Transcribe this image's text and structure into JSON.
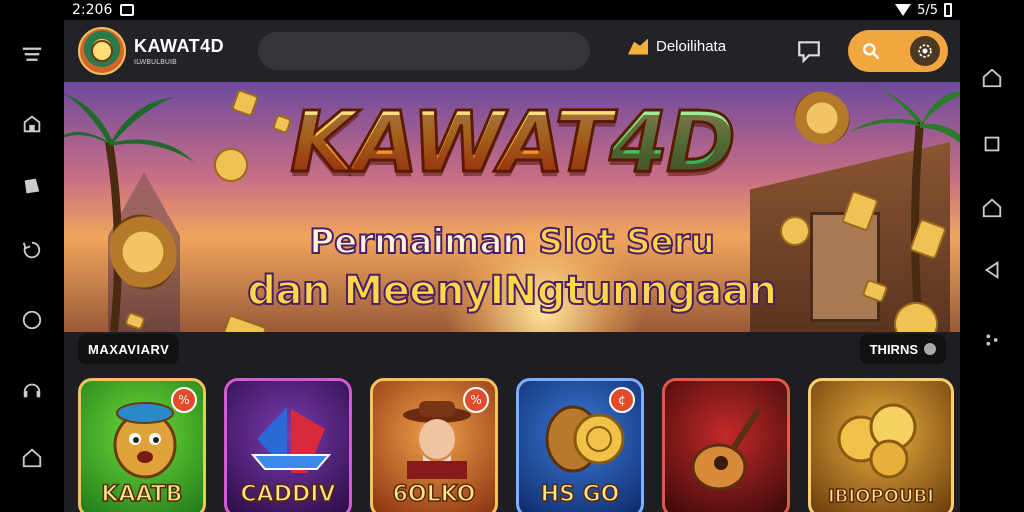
{
  "status_bar": {
    "time": "2:206",
    "signal_text": "5/5"
  },
  "app": {
    "brand_name": "KAWAT4D",
    "brand_subtitle": "ILWBULBUIB",
    "search_placeholder": "",
    "deposit_label": "Deloilihata"
  },
  "banner": {
    "title_main": "KAWAT",
    "title_accent": "4D",
    "subtitle_line1_a": "Permaiman",
    "subtitle_line1_b": "Slot Seru",
    "subtitle_line2": "dan MeenyINgtunngaan"
  },
  "sections": {
    "left_label": "MAXAVIARV",
    "right_label": "THIRNS"
  },
  "games": [
    {
      "label": "KAATB",
      "badge": "%"
    },
    {
      "label": "CADDIV",
      "badge": ""
    },
    {
      "label": "6OLKO",
      "badge": "%"
    },
    {
      "label": "HS GO",
      "badge": "¢"
    },
    {
      "label": "",
      "badge": ""
    },
    {
      "label": "IBIOPOUBI",
      "badge": ""
    }
  ],
  "colors": {
    "accent": "#f2a640",
    "app_bg": "#1d1d22",
    "topbar_bg": "#232327"
  }
}
